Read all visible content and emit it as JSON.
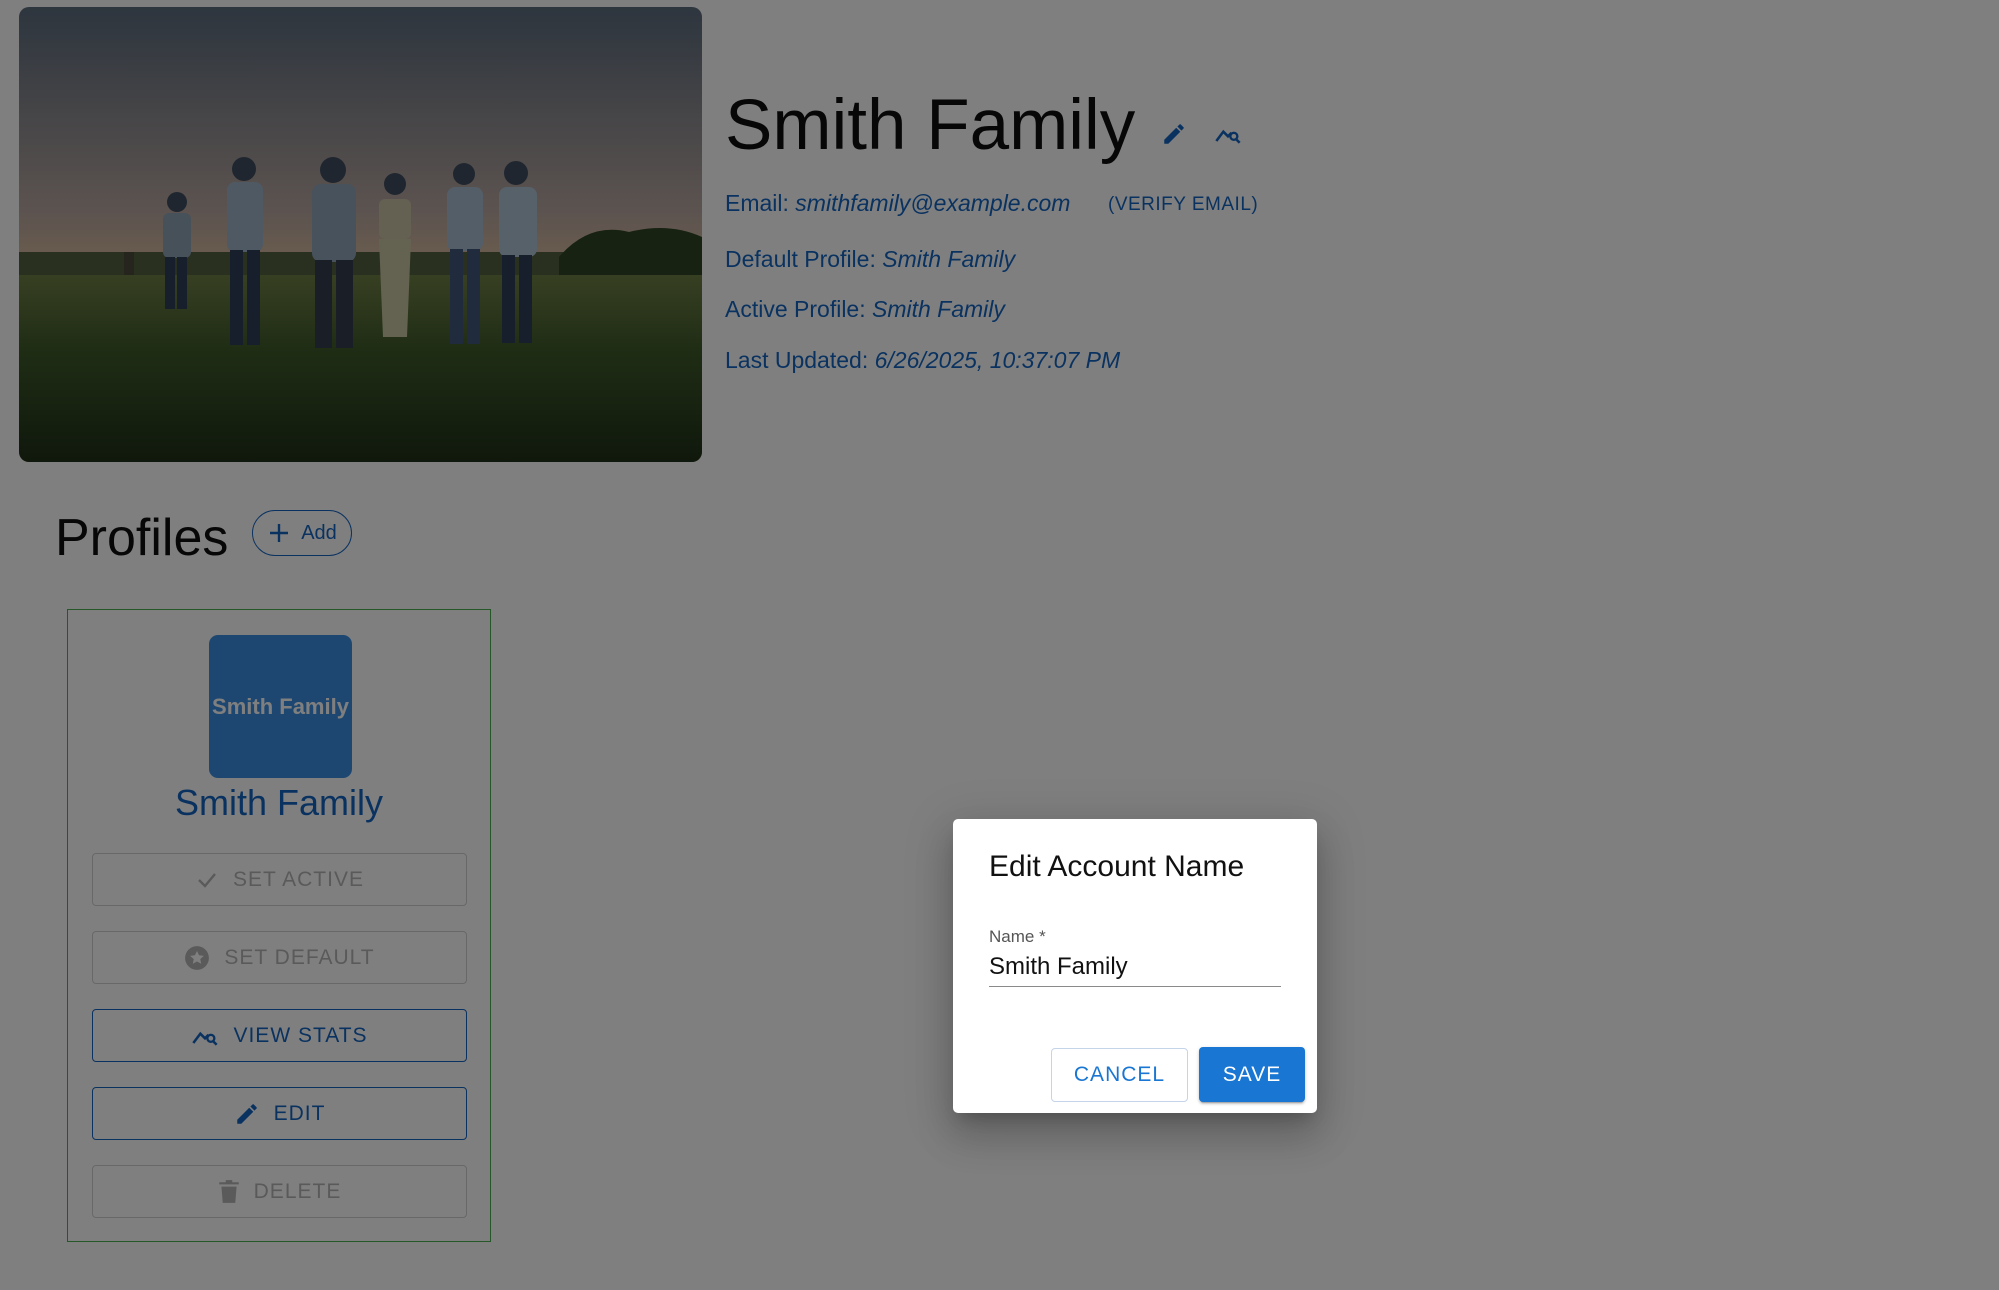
{
  "account": {
    "name": "Smith Family",
    "email_label": "Email:",
    "email": "smithfamily@example.com",
    "verify_label": "(VERIFY EMAIL)",
    "default_profile_label": "Default Profile:",
    "default_profile": "Smith Family",
    "active_profile_label": "Active Profile:",
    "active_profile": "Smith Family",
    "last_updated_label": "Last Updated:",
    "last_updated": "6/26/2025, 10:37:07 PM",
    "photo_icon": "family-photo",
    "edit_icon": "pencil-icon",
    "stats_icon": "query-stats-icon"
  },
  "profiles": {
    "heading": "Profiles",
    "add_label": "Add",
    "add_icon": "plus-icon",
    "items": [
      {
        "avatar_text": "Smith Family",
        "name": "Smith Family",
        "buttons": {
          "set_active": "SET ACTIVE",
          "set_default": "SET DEFAULT",
          "view_stats": "VIEW STATS",
          "edit": "EDIT",
          "delete": "DELETE"
        }
      }
    ]
  },
  "dialog": {
    "title": "Edit Account Name",
    "field_label": "Name *",
    "field_value": "Smith Family",
    "cancel_label": "CANCEL",
    "save_label": "SAVE"
  },
  "colors": {
    "primary": "#1976d2",
    "link": "#1565c0",
    "avatar_bg": "#3b8fe3",
    "card_border": "#4caf50",
    "backdrop": "rgba(0,0,0,0.5)"
  }
}
